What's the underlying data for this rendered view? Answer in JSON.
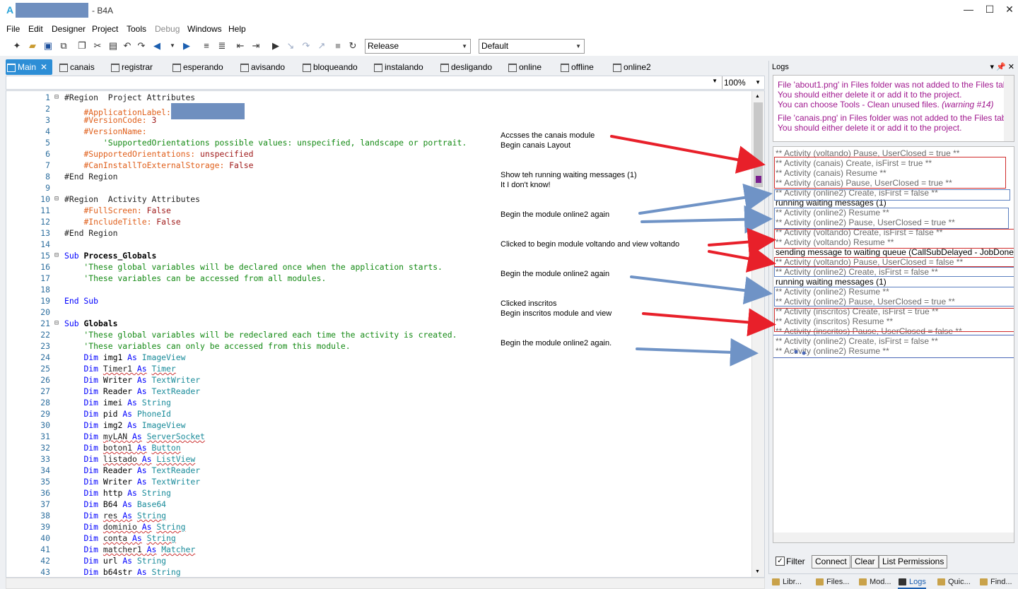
{
  "window": {
    "title_suffix": "- B4A",
    "logo": "A"
  },
  "menu": [
    "File",
    "Edit",
    "Designer",
    "Project",
    "Tools",
    "Debug",
    "Windows",
    "Help"
  ],
  "toolbar": {
    "build_config": "Release",
    "device": "Default"
  },
  "tabs": [
    "Main",
    "canais",
    "registrar",
    "esperando",
    "avisando",
    "bloqueando",
    "instalando",
    "desligando",
    "online",
    "offline",
    "online2"
  ],
  "editor": {
    "zoom": "100%",
    "lines": [
      {
        "n": "1",
        "t": "#Region  Project Attributes"
      },
      {
        "n": "2",
        "t": "    #ApplicationLabel:"
      },
      {
        "n": "3",
        "t": "    #VersionCode: 3"
      },
      {
        "n": "4",
        "t": "    #VersionName:"
      },
      {
        "n": "5",
        "t": "        'SupportedOrientations possible values: unspecified, landscape or portrait."
      },
      {
        "n": "6",
        "t": "    #SupportedOrientations: unspecified"
      },
      {
        "n": "7",
        "t": "    #CanInstallToExternalStorage: False"
      },
      {
        "n": "8",
        "t": "#End Region"
      },
      {
        "n": "9",
        "t": ""
      },
      {
        "n": "10",
        "t": "#Region  Activity Attributes"
      },
      {
        "n": "11",
        "t": "    #FullScreen: False"
      },
      {
        "n": "12",
        "t": "    #IncludeTitle: False"
      },
      {
        "n": "13",
        "t": "#End Region"
      },
      {
        "n": "14",
        "t": ""
      },
      {
        "n": "15",
        "t": "Sub Process_Globals"
      },
      {
        "n": "16",
        "t": "    'These global variables will be declared once when the application starts."
      },
      {
        "n": "17",
        "t": "    'These variables can be accessed from all modules."
      },
      {
        "n": "18",
        "t": ""
      },
      {
        "n": "19",
        "t": "End Sub"
      },
      {
        "n": "20",
        "t": ""
      },
      {
        "n": "21",
        "t": "Sub Globals"
      },
      {
        "n": "22",
        "t": "    'These global variables will be redeclared each time the activity is created."
      },
      {
        "n": "23",
        "t": "    'These variables can only be accessed from this module."
      },
      {
        "n": "24",
        "t": "    Dim img1 As ImageView"
      },
      {
        "n": "25",
        "t": "    Dim Timer1 As Timer"
      },
      {
        "n": "26",
        "t": "    Dim Writer As TextWriter"
      },
      {
        "n": "27",
        "t": "    Dim Reader As TextReader"
      },
      {
        "n": "28",
        "t": "    Dim imei As String"
      },
      {
        "n": "29",
        "t": "    Dim pid As PhoneId"
      },
      {
        "n": "30",
        "t": "    Dim img2 As ImageView"
      },
      {
        "n": "31",
        "t": "    Dim myLAN As ServerSocket"
      },
      {
        "n": "32",
        "t": "    Dim boton1 As Button"
      },
      {
        "n": "33",
        "t": "    Dim listado As ListView"
      },
      {
        "n": "34",
        "t": "    Dim Reader As TextReader"
      },
      {
        "n": "35",
        "t": "    Dim Writer As TextWriter"
      },
      {
        "n": "36",
        "t": "    Dim http As String"
      },
      {
        "n": "37",
        "t": "    Dim B64 As Base64"
      },
      {
        "n": "38",
        "t": "    Dim res As String"
      },
      {
        "n": "39",
        "t": "    Dim dominio As String"
      },
      {
        "n": "40",
        "t": "    Dim conta As String"
      },
      {
        "n": "41",
        "t": "    Dim matcher1 As Matcher"
      },
      {
        "n": "42",
        "t": "    Dim url As String"
      },
      {
        "n": "43",
        "t": "    Dim b64str As String"
      }
    ]
  },
  "annotations": [
    "Accsses the canais module",
    "Begin canais Layout",
    "Show teh running waiting messages (1)",
    "It I don't know!",
    "Begin the module online2 again",
    "Clicked to begin module voltando and view voltando",
    "Begin the module online2 again",
    "Clicked inscritos",
    "Begin inscritos module and view",
    "Begin the module online2 again."
  ],
  "logs_panel": {
    "title": "Logs",
    "warnings": [
      "File 'about1.png' in Files folder was not added to the Files tab.",
      "You should either delete it or add it to the project.",
      "You can choose Tools - Clean unused files.",
      "(warning #14)",
      "File 'canais.png' in Files folder was not added to the Files tab.",
      "You should either delete it or add it to the project."
    ],
    "log_lines": [
      "** Activity (voltando) Pause, UserClosed = true **",
      "** Activity (canais) Create, isFirst = true **",
      "** Activity (canais) Resume **",
      "** Activity (canais) Pause, UserClosed = true **",
      "** Activity (online2) Create, isFirst = false **",
      "running waiting messages (1)",
      "** Activity (online2) Resume **",
      "** Activity (online2) Pause, UserClosed = true **",
      "** Activity (voltando) Create, isFirst = false **",
      "** Activity (voltando) Resume **",
      "sending message to waiting queue (CallSubDelayed - JobDone)",
      "** Activity (voltando) Pause, UserClosed = false **",
      "** Activity (online2) Create, isFirst = false **",
      "running waiting messages (1)",
      "** Activity (online2) Resume **",
      "** Activity (online2) Pause, UserClosed = true **",
      "** Activity (inscritos) Create, isFirst = true **",
      "** Activity (inscritos) Resume **",
      "** Activity (inscritos) Pause, UserClosed = false **",
      "** Activity (online2) Create, isFirst = false **",
      "** Activity (online2) Resume **"
    ],
    "filter_label": "Filter",
    "connect_label": "Connect",
    "clear_label": "Clear",
    "permissions_label": "List Permissions",
    "bottom_tabs": [
      "Libr...",
      "Files...",
      "Mod...",
      "Logs",
      "Quic...",
      "Find..."
    ]
  },
  "colors": {
    "accent": "#2d8ed6",
    "warning": "#a0198f",
    "red_arrow": "#e8202a",
    "blue_arrow": "#6f93c6"
  }
}
